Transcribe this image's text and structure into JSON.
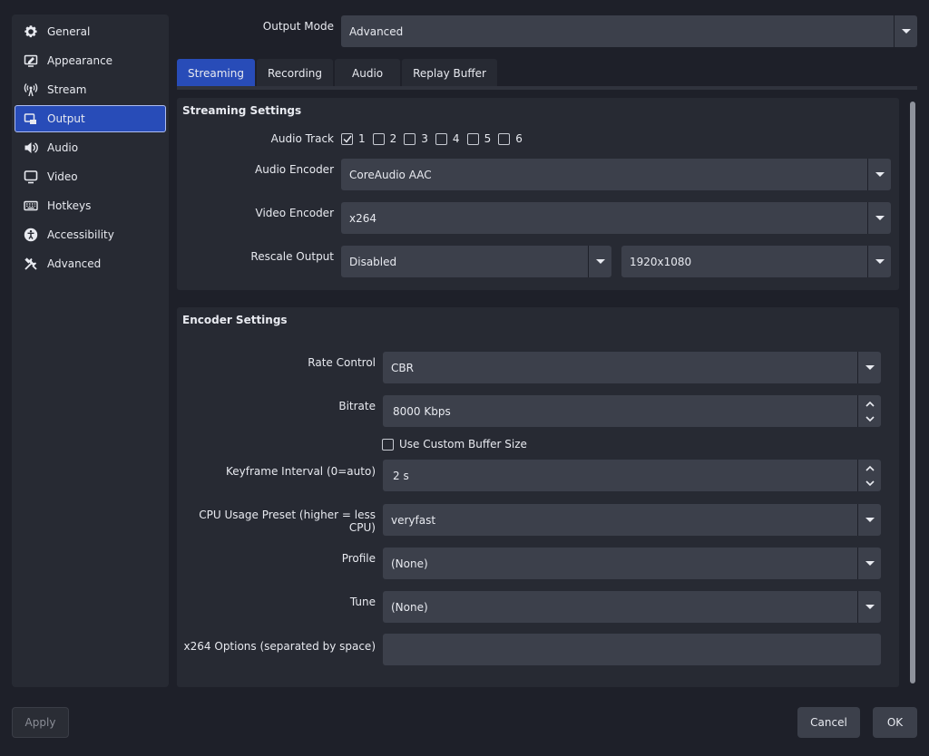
{
  "sidebar": {
    "items": [
      {
        "label": "General",
        "icon": "gear-icon",
        "active": false
      },
      {
        "label": "Appearance",
        "icon": "appearance-icon",
        "active": false
      },
      {
        "label": "Stream",
        "icon": "antenna-icon",
        "active": false
      },
      {
        "label": "Output",
        "icon": "output-icon",
        "active": true
      },
      {
        "label": "Audio",
        "icon": "speaker-icon",
        "active": false
      },
      {
        "label": "Video",
        "icon": "monitor-icon",
        "active": false
      },
      {
        "label": "Hotkeys",
        "icon": "keyboard-icon",
        "active": false
      },
      {
        "label": "Accessibility",
        "icon": "accessibility-icon",
        "active": false
      },
      {
        "label": "Advanced",
        "icon": "tools-icon",
        "active": false
      }
    ]
  },
  "output_mode": {
    "label": "Output Mode",
    "value": "Advanced"
  },
  "tabs": [
    {
      "label": "Streaming",
      "active": true
    },
    {
      "label": "Recording",
      "active": false
    },
    {
      "label": "Audio",
      "active": false
    },
    {
      "label": "Replay Buffer",
      "active": false
    }
  ],
  "streaming": {
    "title": "Streaming Settings",
    "audio_track": {
      "label": "Audio Track",
      "tracks": [
        {
          "label": "1",
          "checked": true
        },
        {
          "label": "2",
          "checked": false
        },
        {
          "label": "3",
          "checked": false
        },
        {
          "label": "4",
          "checked": false
        },
        {
          "label": "5",
          "checked": false
        },
        {
          "label": "6",
          "checked": false
        }
      ]
    },
    "audio_encoder": {
      "label": "Audio Encoder",
      "value": "CoreAudio AAC"
    },
    "video_encoder": {
      "label": "Video Encoder",
      "value": "x264"
    },
    "rescale": {
      "label": "Rescale Output",
      "value": "Disabled",
      "resolution": "1920x1080"
    }
  },
  "encoder": {
    "title": "Encoder Settings",
    "rate_control": {
      "label": "Rate Control",
      "value": "CBR"
    },
    "bitrate": {
      "label": "Bitrate",
      "value": "8000 Kbps"
    },
    "custom_buffer": {
      "label": "Use Custom Buffer Size",
      "checked": false
    },
    "keyframe": {
      "label": "Keyframe Interval (0=auto)",
      "value": "2 s"
    },
    "cpu_preset": {
      "label": "CPU Usage Preset (higher = less CPU)",
      "value": "veryfast"
    },
    "profile": {
      "label": "Profile",
      "value": "(None)"
    },
    "tune": {
      "label": "Tune",
      "value": "(None)"
    },
    "x264_options": {
      "label": "x264 Options (separated by space)",
      "value": ""
    }
  },
  "buttons": {
    "apply": "Apply",
    "cancel": "Cancel",
    "ok": "OK"
  },
  "colors": {
    "accent": "#284cb8",
    "background": "#1e2029",
    "panel": "#272a33",
    "field": "#3c404b"
  }
}
